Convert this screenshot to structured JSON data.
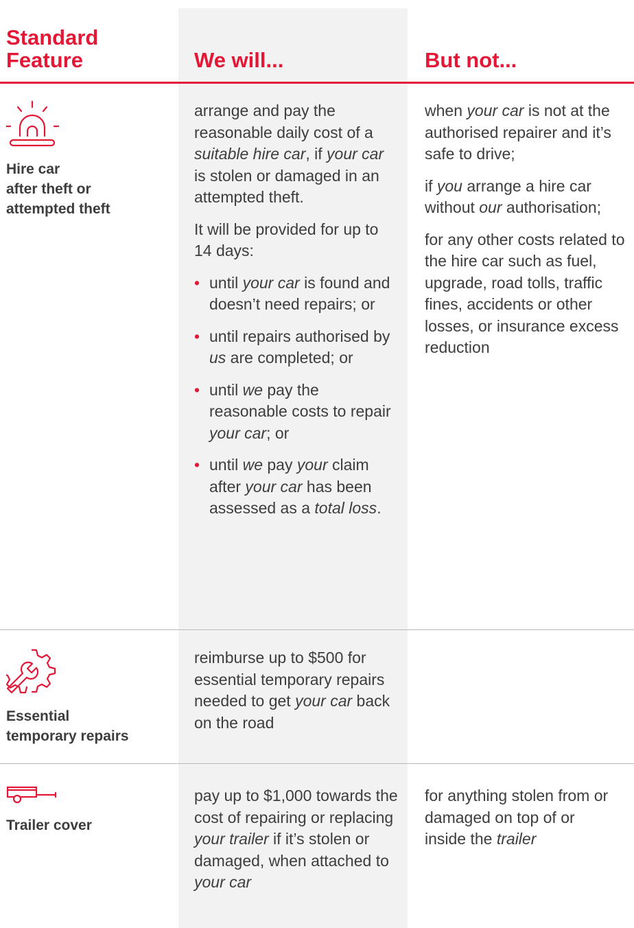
{
  "colors": {
    "accent": "#e31837",
    "text": "#3d3d3d",
    "shade": "#f2f2f2",
    "divider": "#b9b9b9"
  },
  "header": {
    "feature": "Standard\nFeature",
    "we_will": "We will...",
    "but_not": "But not..."
  },
  "rows": [
    {
      "icon": "siren-alarm-icon",
      "feature": "Hire car\nafter theft or\nattempted theft",
      "we_will": {
        "p1": [
          {
            "t": "arrange and pay the reasonable daily cost of a "
          },
          {
            "t": "suitable hire car",
            "i": true
          },
          {
            "t": ", if "
          },
          {
            "t": "your car",
            "i": true
          },
          {
            "t": " is stolen or damaged in an attempted theft."
          }
        ],
        "p2": "It will be provided for up to 14 days:",
        "bullets": [
          [
            {
              "t": "until "
            },
            {
              "t": "your car",
              "i": true
            },
            {
              "t": " is found and doesn’t need repairs; or"
            }
          ],
          [
            {
              "t": "until repairs authorised by "
            },
            {
              "t": "us",
              "i": true
            },
            {
              "t": " are completed; or"
            }
          ],
          [
            {
              "t": "until "
            },
            {
              "t": "we",
              "i": true
            },
            {
              "t": " pay the reasonable costs to repair "
            },
            {
              "t": "your car",
              "i": true
            },
            {
              "t": "; or"
            }
          ],
          [
            {
              "t": "until "
            },
            {
              "t": "we",
              "i": true
            },
            {
              "t": " pay "
            },
            {
              "t": "your",
              "i": true
            },
            {
              "t": " claim after "
            },
            {
              "t": "your car",
              "i": true
            },
            {
              "t": " has been assessed as a "
            },
            {
              "t": "total loss",
              "i": true
            },
            {
              "t": "."
            }
          ]
        ]
      },
      "but_not": [
        [
          {
            "t": "when "
          },
          {
            "t": "your car",
            "i": true
          },
          {
            "t": " is not at the authorised repairer and it’s safe to drive;"
          }
        ],
        [
          {
            "t": "if "
          },
          {
            "t": "you",
            "i": true
          },
          {
            "t": " arrange a hire car without "
          },
          {
            "t": "our",
            "i": true
          },
          {
            "t": " authorisation;"
          }
        ],
        [
          {
            "t": "for any other costs related to the hire car such as fuel, upgrade, road tolls, traffic fines, accidents or other losses, or insurance excess reduction"
          }
        ]
      ]
    },
    {
      "icon": "gear-wrench-icon",
      "feature": "Essential\ntemporary repairs",
      "we_will": [
        [
          {
            "t": "reimburse up to $500 for essential temporary repairs needed to get "
          },
          {
            "t": "your car",
            "i": true
          },
          {
            "t": " back on the road"
          }
        ]
      ],
      "but_not": []
    },
    {
      "icon": "trailer-icon",
      "feature": "Trailer cover",
      "we_will": [
        [
          {
            "t": "pay up to $1,000 towards the cost of repairing or replacing "
          },
          {
            "t": "your trailer",
            "i": true
          },
          {
            "t": " if it’s stolen or damaged, when attached to "
          },
          {
            "t": "your car",
            "i": true
          }
        ]
      ],
      "but_not": [
        [
          {
            "t": "for anything stolen from or damaged on top of or inside the "
          },
          {
            "t": "trailer",
            "i": true
          }
        ]
      ]
    }
  ]
}
